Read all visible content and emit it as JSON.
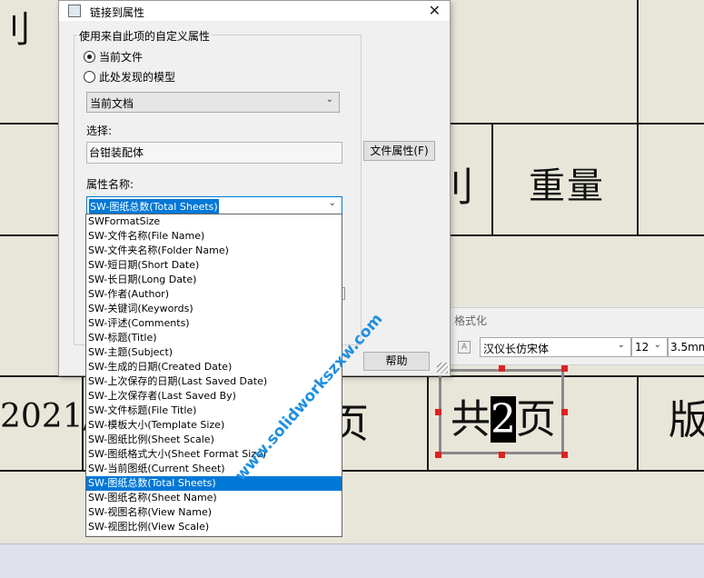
{
  "dialog": {
    "title": "链接到属性",
    "group_label": "使用来自此项的自定义属性",
    "radio_current_file": "当前文件",
    "radio_model_found": "此处发现的模型",
    "source_combo_value": "当前文档",
    "selection_label": "选择:",
    "selection_value": "台钳装配体",
    "file_properties_button": "文件属性(F)",
    "property_name_label": "属性名称:",
    "property_combo_value": "SW-图纸总数(Total Sheets)",
    "help_button": "帮助",
    "property_list": [
      "SWFormatSize",
      "SW-文件名称(File Name)",
      "SW-文件夹名称(Folder Name)",
      "SW-短日期(Short Date)",
      "SW-长日期(Long Date)",
      "SW-作者(Author)",
      "SW-关键词(Keywords)",
      "SW-评述(Comments)",
      "SW-标题(Title)",
      "SW-主题(Subject)",
      "SW-生成的日期(Created Date)",
      "SW-上次保存的日期(Last Saved Date)",
      "SW-上次保存者(Last Saved By)",
      "SW-文件标题(File Title)",
      "SW-模板大小(Template Size)",
      "SW-图纸比例(Sheet Scale)",
      "SW-图纸格式大小(Sheet Format Size)",
      "SW-当前图纸(Current Sheet)",
      "SW-图纸总数(Total Sheets)",
      "SW-图纸名称(Sheet Name)",
      "SW-视图名称(View Name)",
      "SW-视图比例(View Scale)"
    ],
    "selected_index": 18
  },
  "format_panel": {
    "title": "格式化",
    "font_value": "汉仪长仿宋体",
    "size_value": "12",
    "height_value": "3.5mm"
  },
  "drawing": {
    "weight_label": "重量",
    "year_text": "2021/",
    "edit_text_before": "共",
    "edit_text_highlight": "2",
    "edit_text_after": "页",
    "version_char": "版",
    "partial_char_left": "页"
  },
  "watermark": "www.solidworkszxw.com",
  "colors": {
    "selection": "#0078d7",
    "watermark": "#1e8fe0",
    "handle": "#e02020"
  }
}
